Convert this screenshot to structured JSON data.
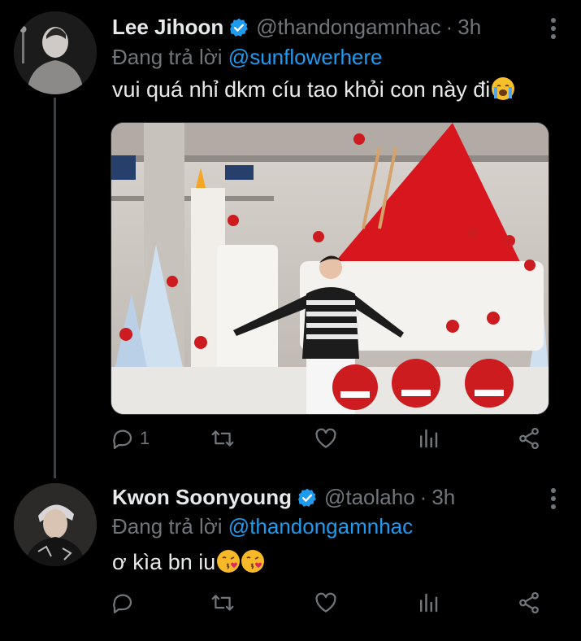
{
  "tweets": [
    {
      "name": "Lee Jihoon",
      "handle": "@thandongamnhac",
      "separator": "·",
      "time": "3h",
      "reply_prefix": "Đang trả lời",
      "reply_to": "@sunflowerhere",
      "text": "vui quá nhỉ dkm cíu tao khỏi con này đi",
      "emoji": "loudly-crying-face-emoji",
      "reply_count": "1"
    },
    {
      "name": "Kwon Soonyoung",
      "handle": "@taolaho",
      "separator": "·",
      "time": "3h",
      "reply_prefix": "Đang trả lời",
      "reply_to": "@thandongamnhac",
      "text": "ơ kìa bn iu",
      "emoji": "face-blowing-kiss-emoji",
      "reply_count": ""
    }
  ],
  "colors": {
    "background": "#000000",
    "text": "#e7e9ea",
    "muted": "#71767b",
    "accent": "#1d9bf0",
    "thread_line": "#3e4144"
  },
  "icons": [
    "verified-badge-icon",
    "more-icon",
    "reply-icon",
    "retweet-icon",
    "like-icon",
    "stats-icon",
    "share-icon"
  ]
}
